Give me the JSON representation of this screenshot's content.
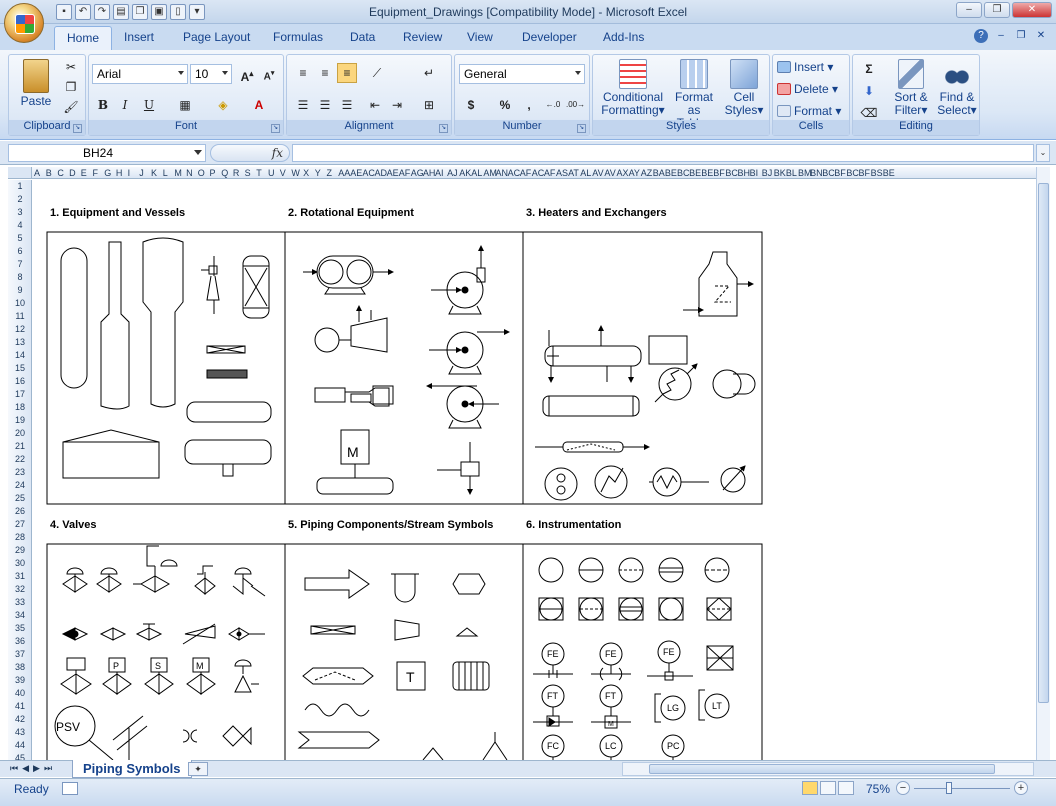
{
  "window": {
    "title": "Equipment_Drawings  [Compatibility Mode] - Microsoft Excel"
  },
  "tabs": [
    "Home",
    "Insert",
    "Page Layout",
    "Formulas",
    "Data",
    "Review",
    "View",
    "Developer",
    "Add-Ins"
  ],
  "ribbon": {
    "clipboard": {
      "label": "Clipboard",
      "paste": "Paste"
    },
    "font": {
      "label": "Font",
      "name": "Arial",
      "size": "10",
      "bold": "B",
      "italic": "I",
      "underline": "U"
    },
    "alignment": {
      "label": "Alignment"
    },
    "number": {
      "label": "Number",
      "format": "General",
      "currency": "$",
      "percent": "%",
      "comma": ","
    },
    "styles": {
      "label": "Styles",
      "conditional_1": "Conditional",
      "conditional_2": "Formatting",
      "table_1": "Format",
      "table_2": "as Table",
      "cell_1": "Cell",
      "cell_2": "Styles"
    },
    "cells": {
      "label": "Cells",
      "insert": "Insert",
      "delete": "Delete",
      "format": "Format"
    },
    "editing": {
      "label": "Editing",
      "sort_1": "Sort &",
      "sort_2": "Filter",
      "find_1": "Find &",
      "find_2": "Select"
    }
  },
  "formula_bar": {
    "name_box": "BH24",
    "fx": "fx",
    "value": ""
  },
  "columns": [
    "A",
    "B",
    "C",
    "D",
    "E",
    "F",
    "G",
    "H",
    "I",
    "J",
    "K",
    "L",
    "M",
    "N",
    "O",
    "P",
    "Q",
    "R",
    "S",
    "T",
    "U",
    "V",
    "W",
    "X",
    "Y",
    "Z",
    "AA",
    "AE",
    "AC",
    "AD",
    "AE",
    "AF",
    "AG",
    "AH",
    "AI",
    "AJ",
    "AK",
    "AL",
    "AM",
    "AN",
    "AC",
    "AF",
    "AC",
    "AF",
    "AS",
    "AT",
    "AL",
    "AV",
    "AV",
    "AX",
    "AY",
    "AZ",
    "BA",
    "BE",
    "BC",
    "BE",
    "BE",
    "BF",
    "BC",
    "BH",
    "BI",
    "BJ",
    "BK",
    "BL",
    "BM",
    "BN",
    "BC",
    "BF",
    "BC",
    "BF",
    "BS",
    "BE"
  ],
  "rows": [
    "1",
    "2",
    "3",
    "4",
    "5",
    "6",
    "7",
    "8",
    "9",
    "10",
    "11",
    "12",
    "13",
    "14",
    "15",
    "16",
    "17",
    "18",
    "19",
    "20",
    "21",
    "22",
    "23",
    "24",
    "25",
    "26",
    "27",
    "28",
    "29",
    "30",
    "31",
    "32",
    "33",
    "34",
    "35",
    "36",
    "37",
    "38",
    "39",
    "40",
    "41",
    "42",
    "43",
    "44",
    "45"
  ],
  "sections": [
    {
      "title": "1.  Equipment and Vessels"
    },
    {
      "title": "2.  Rotational Equipment"
    },
    {
      "title": "3.  Heaters and Exchangers"
    },
    {
      "title": "4.  Valves"
    },
    {
      "title": "5.  Piping Components/Stream Symbols"
    },
    {
      "title": "6.  Instrumentation"
    }
  ],
  "symbol_labels": {
    "motor": "M",
    "solenoid": "S",
    "pneumatic": "P",
    "motor_valve": "M",
    "psv": "PSV",
    "transmitter": "T",
    "fe": "FE",
    "ft": "FT",
    "lg": "LG",
    "lt": "LT",
    "fc": "FC",
    "lc": "LC",
    "pc": "PC",
    "meter_m": "M"
  },
  "sheet_tabs": [
    "Piping Symbols"
  ],
  "status": {
    "ready": "Ready",
    "zoom": "75%"
  },
  "colors": {
    "ribbon_bg": "#dbe7f6",
    "title_bg": "#c4d6ec",
    "accent": "#15428b"
  }
}
